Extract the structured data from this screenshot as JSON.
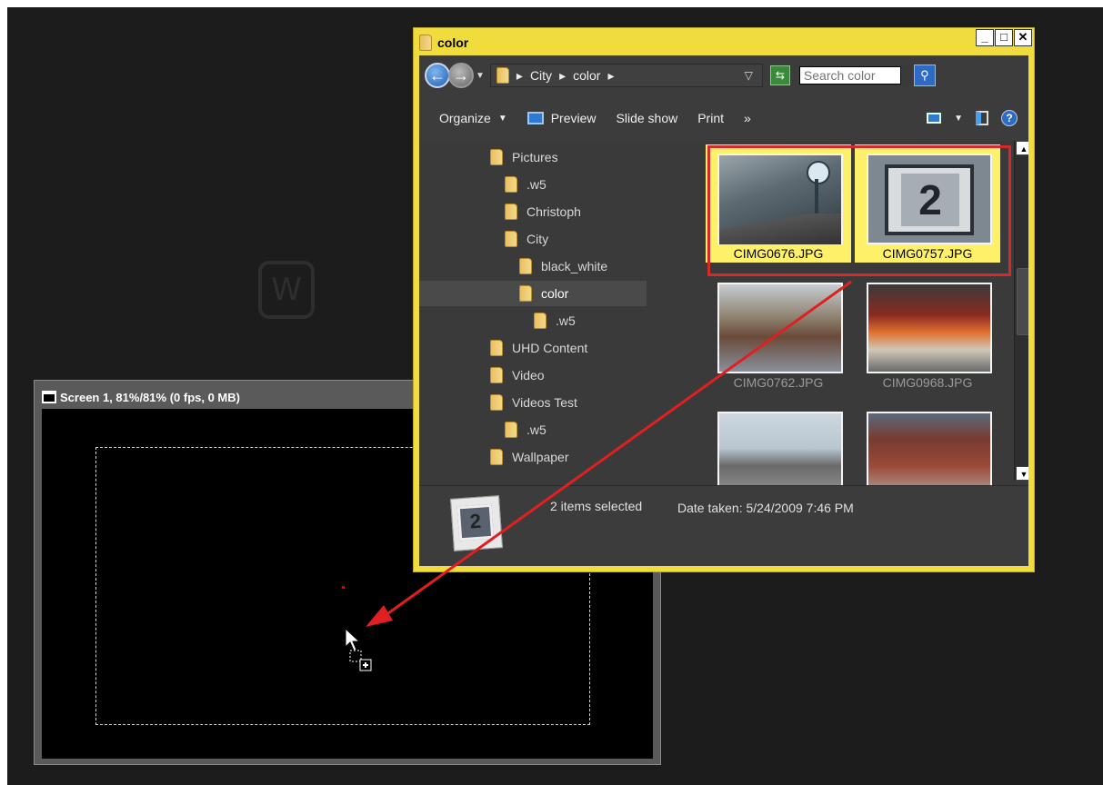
{
  "screen_window": {
    "title": "Screen 1, 81%/81% (0 fps, 0 MB)"
  },
  "watermark": {
    "letter": "W"
  },
  "explorer": {
    "title": "color",
    "window_buttons": {
      "minimize": "_",
      "maximize": "□",
      "close": "✕"
    },
    "address": {
      "crumbs": [
        "City",
        "color"
      ],
      "separator": "▸"
    },
    "search": {
      "placeholder": "Search color"
    },
    "toolbar": {
      "organize": "Organize",
      "preview": "Preview",
      "slideshow": "Slide show",
      "print": "Print",
      "more": "»"
    },
    "tree": [
      {
        "label": "Pictures",
        "level": 0
      },
      {
        "label": ".w5",
        "level": 1
      },
      {
        "label": "Christoph",
        "level": 1
      },
      {
        "label": "City",
        "level": 1
      },
      {
        "label": "black_white",
        "level": 2
      },
      {
        "label": "color",
        "level": 2,
        "selected": true
      },
      {
        "label": ".w5",
        "level": 3
      },
      {
        "label": "UHD Content",
        "level": 0
      },
      {
        "label": "Video",
        "level": 0
      },
      {
        "label": "Videos Test",
        "level": 0
      },
      {
        "label": ".w5",
        "level": 1
      },
      {
        "label": "Wallpaper",
        "level": 0
      }
    ],
    "files": [
      {
        "name": "CIMG0676.JPG",
        "selected": true
      },
      {
        "name": "CIMG0757.JPG",
        "selected": true
      },
      {
        "name": "CIMG0762.JPG",
        "selected": false
      },
      {
        "name": "CIMG0968.JPG",
        "selected": false
      },
      {
        "name": "",
        "selected": false
      },
      {
        "name": "",
        "selected": false
      }
    ],
    "status": {
      "count": "2 items selected",
      "date": "Date taken: 5/24/2009 7:46 PM",
      "thumb_text": "2"
    }
  },
  "colors": {
    "explorer_frame": "#f0dc3c",
    "selection_highlight": "#fff06a",
    "annotation_red": "#e02020"
  }
}
